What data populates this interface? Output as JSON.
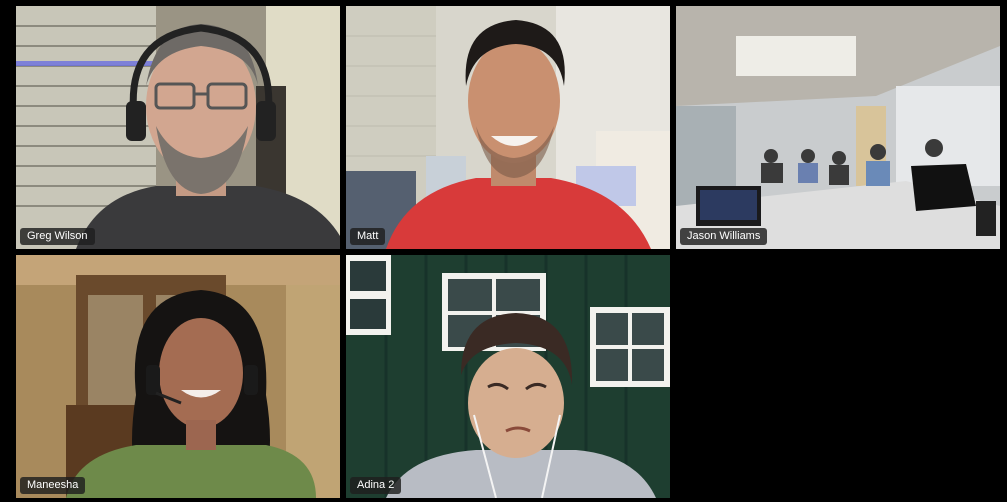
{
  "participants": [
    {
      "name": "Greg Wilson"
    },
    {
      "name": "Matt"
    },
    {
      "name": "Jason Williams"
    },
    {
      "name": "Maneesha"
    },
    {
      "name": "Adina 2"
    }
  ],
  "colors": {
    "background": "#000000",
    "name_tag_bg": "#1e1e1e",
    "name_tag_text": "#ffffff"
  }
}
